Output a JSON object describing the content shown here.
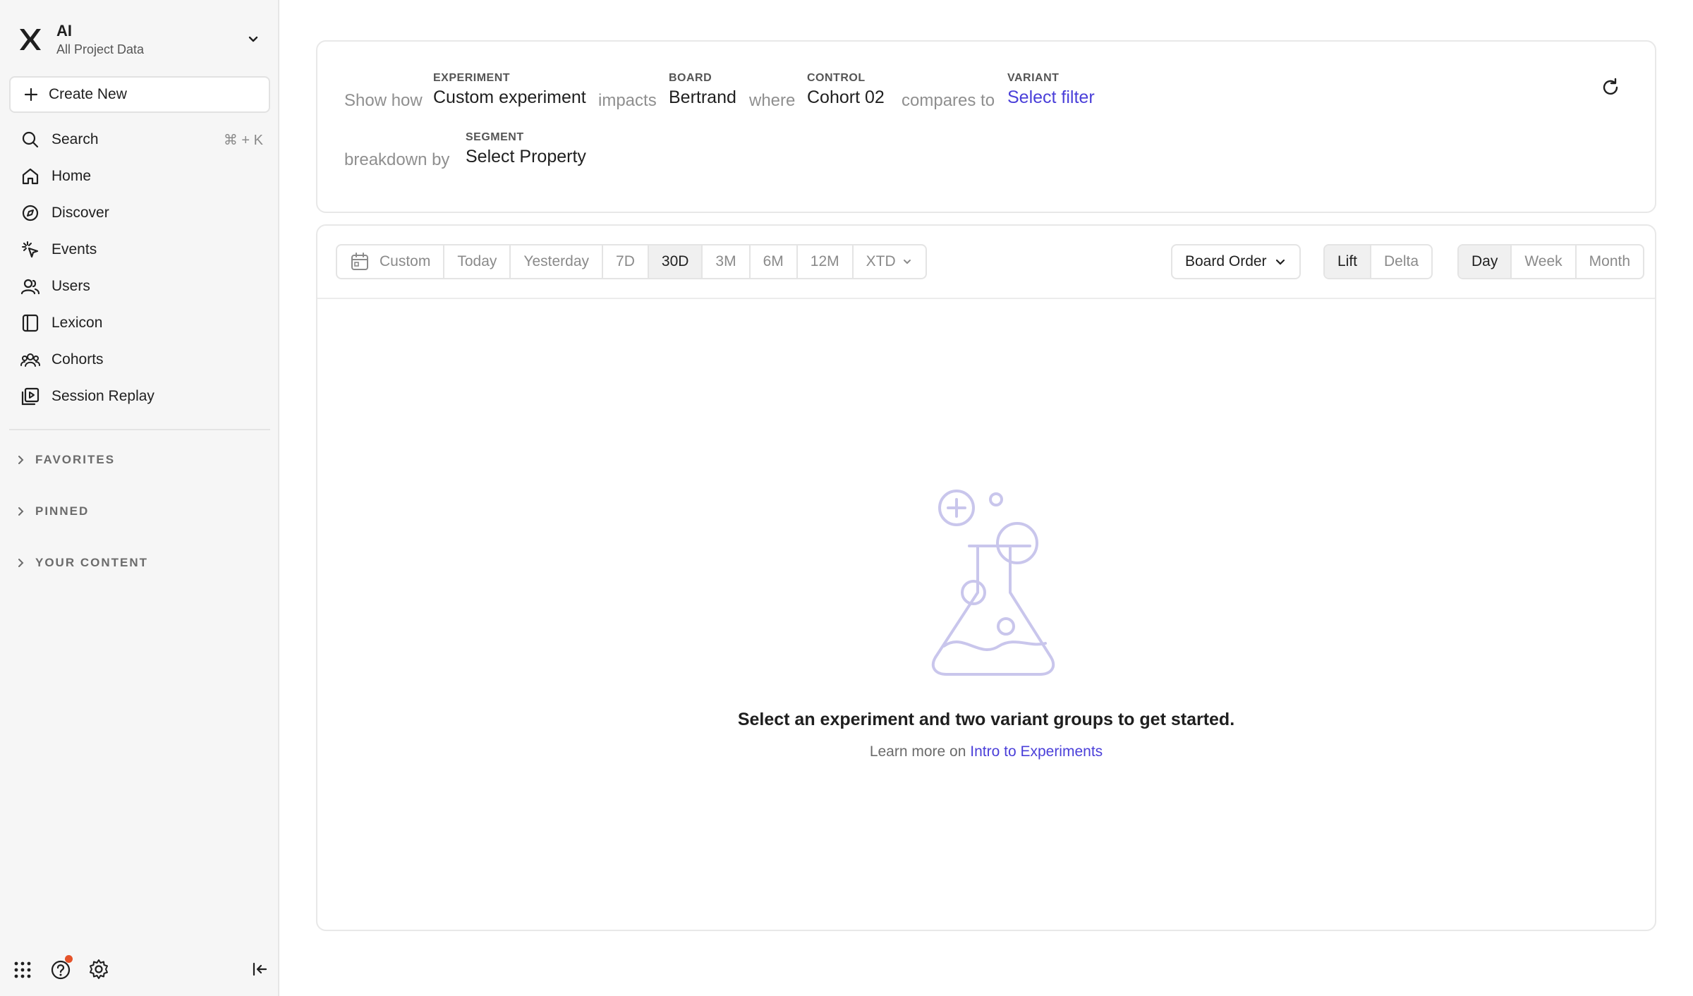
{
  "project": {
    "name": "AI",
    "subtitle": "All Project Data"
  },
  "sidebar": {
    "create_label": "Create New",
    "search_label": "Search",
    "search_shortcut": "⌘ + K",
    "items": [
      {
        "label": "Home",
        "icon": "home-icon"
      },
      {
        "label": "Discover",
        "icon": "compass-icon"
      },
      {
        "label": "Events",
        "icon": "cursor-click-icon"
      },
      {
        "label": "Users",
        "icon": "users-icon"
      },
      {
        "label": "Lexicon",
        "icon": "book-icon"
      },
      {
        "label": "Cohorts",
        "icon": "cohorts-icon"
      },
      {
        "label": "Session Replay",
        "icon": "replay-icon"
      }
    ],
    "sections": [
      "FAVORITES",
      "PINNED",
      "YOUR CONTENT"
    ]
  },
  "query": {
    "show_how": "Show how",
    "experiment_label": "EXPERIMENT",
    "experiment_value": "Custom experiment",
    "impacts": "impacts",
    "board_label": "BOARD",
    "board_value": "Bertrand",
    "where": "where",
    "control_label": "CONTROL",
    "control_value": "Cohort 02",
    "compares_to": "compares to",
    "variant_label": "VARIANT",
    "variant_value": "Select filter",
    "breakdown_by": "breakdown by",
    "segment_label": "SEGMENT",
    "segment_value": "Select Property"
  },
  "toolbar": {
    "date_ranges": [
      "Custom",
      "Today",
      "Yesterday",
      "7D",
      "30D",
      "3M",
      "6M",
      "12M",
      "XTD"
    ],
    "active_range": "30D",
    "sort": "Board Order",
    "mode_options": [
      "Lift",
      "Delta"
    ],
    "active_mode": "Lift",
    "interval_options": [
      "Day",
      "Week",
      "Month"
    ],
    "active_interval": "Day"
  },
  "empty_state": {
    "title": "Select an experiment and two variant groups to get started.",
    "learn_more": "Learn more on",
    "link_text": "Intro to Experiments"
  },
  "colors": {
    "link": "#4a3fd9",
    "illustration": "#c9c6ec",
    "notification": "#e5532a"
  }
}
